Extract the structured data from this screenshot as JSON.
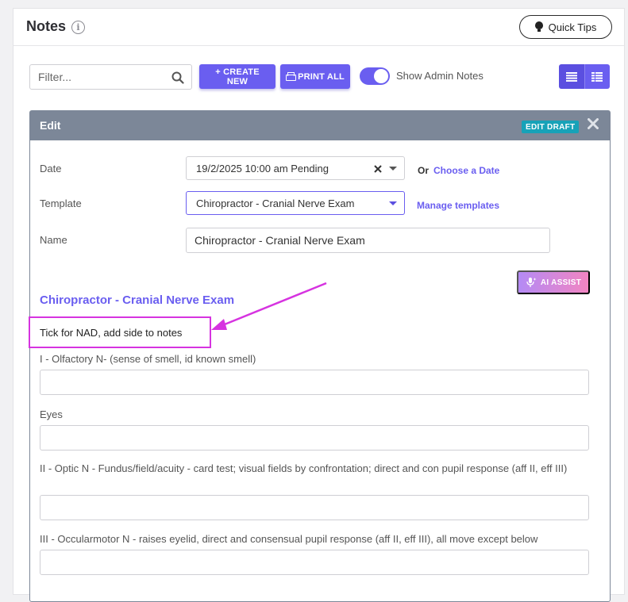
{
  "header": {
    "title": "Notes",
    "quick_tips_label": "Quick Tips"
  },
  "toolbar": {
    "filter_placeholder": "Filter...",
    "create_label": "+ CREATE NEW",
    "print_label": "PRINT ALL",
    "admin_toggle_label": "Show Admin Notes",
    "admin_toggle_on": true
  },
  "edit": {
    "title": "Edit",
    "badge": "EDIT DRAFT",
    "date_label": "Date",
    "date_value": "19/2/2025 10:00 am Pending",
    "or_text": "Or",
    "choose_date_link": "Choose a Date",
    "template_label": "Template",
    "template_value": "Chiropractor - Cranial Nerve Exam",
    "manage_templates_link": "Manage templates",
    "name_label": "Name",
    "name_value": "Chiropractor - Cranial Nerve Exam",
    "ai_assist_label": "AI ASSIST",
    "template_heading": "Chiropractor - Cranial Nerve Exam",
    "note_text": "Tick for NAD, add side to notes",
    "questions": [
      {
        "label": "I - Olfactory N- (sense of smell, id known smell)"
      },
      {
        "label": "Eyes"
      },
      {
        "label": "II - Optic N - Fundus/field/acuity - card test; visual fields by confrontation; direct and con pupil response (aff II, eff III)"
      },
      {
        "label": "III - Occularmotor N - raises eyelid, direct and consensual pupil response (aff II, eff III), all move except below"
      }
    ]
  },
  "colors": {
    "accent": "#6a5ef0",
    "header_gray": "#7c8798",
    "badge": "#17a2b8",
    "annotation": "#d633e0"
  }
}
